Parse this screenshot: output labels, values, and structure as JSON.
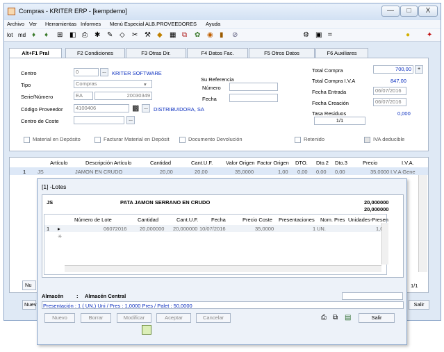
{
  "window": {
    "title": "Compras - KRITER ERP - [kempdemo]",
    "minimize": "—",
    "maximize": "□",
    "close": "X"
  },
  "menu": [
    "Archivo",
    "Ver",
    "Herramientas",
    "Informes",
    "Menú Especial ALB.PROVEEDORES",
    "Ayuda"
  ],
  "toolbar": {
    "lot": "lot",
    "md": "md"
  },
  "tabs": [
    "Alt+F1 Pral",
    "F2 Condiciones",
    "F3 Otras Dir.",
    "F4 Datos Fac.",
    "F5 Otros Datos",
    "F6 Auxiliares"
  ],
  "form": {
    "centro_label": "Centro",
    "centro_value": "0",
    "centro_name": "KRITER SOFTWARE",
    "tipo_label": "Tipo",
    "tipo_value": "Compras",
    "serie_label": "Serie/Número",
    "serie_value": "EA",
    "numero_value": "20030349",
    "codprov_label": "Código Proveedor",
    "codprov_value": "4100406",
    "prov_name": "DISTRIBUIDORA, SA",
    "coste_label": "Centro de Coste",
    "suref_label": "Su Referencia",
    "numero_label": "Número",
    "fecha_label": "Fecha",
    "total_compra_label": "Total Compra",
    "total_compra_value": "700,00",
    "total_iva_label": "Total Compra I.V.A",
    "total_iva_value": "847,00",
    "fecha_entrada_label": "Fecha Entrada",
    "fecha_entrada_value": "06/07/2016",
    "fecha_creacion_label": "Fecha Creación",
    "fecha_creacion_value": "06/07/2016",
    "tasa_label": "Tasa Residuos",
    "tasa_value": "0,000",
    "page": "1/1",
    "checks": [
      "Material en Depósito",
      "Facturar Material en Depósit",
      "Documento Devolución",
      "Retenido",
      "IVA deducible"
    ]
  },
  "grid": {
    "headers": [
      "Artículo",
      "Descripción Artículo",
      "Cantidad",
      "Cant.U.F.",
      "Valor Origen",
      "Factor Origen",
      "DTO.",
      "Dto.2",
      "Dto.3",
      "Precio",
      "I.V.A."
    ],
    "row": [
      "1",
      "JS",
      "JAMON EN CRUDO",
      "20,00",
      "20,00",
      "35,0000",
      "1,00",
      "0,00",
      "0,00",
      "0,00",
      "35,0000",
      "I.V.A Gene"
    ],
    "page": "1/1",
    "bottom_left": "Nu",
    "bottom_left2": "Nuev",
    "exit": "Salir"
  },
  "lotes": {
    "title": "[1] -Lotes",
    "code": "JS",
    "description": "PATA JAMON SERRANO EN CRUDO",
    "qty1": "20,000000",
    "qty2": "20,000000",
    "headers": [
      "Número de Lote",
      "Cantidad",
      "Cant.U.F.",
      "Fecha",
      "Precio Coste",
      "Presentaciones",
      "Nom. Pres",
      "Unidades-Presen"
    ],
    "row": [
      "1",
      "06072016",
      "20,000000",
      "20,000000",
      "10/07/2016",
      "35,0000",
      "1",
      "UN.",
      "1,0"
    ],
    "almacen_label": "Almacén",
    "almacen_sep": ":",
    "almacen_value": "Almacén Central",
    "presentacion": "Presentación : 1  ( UN.)  Uni / Pres : 1,0000 Pres / Palet : 50,0000",
    "buttons": [
      "Nuevo",
      "Borrar",
      "Modificar",
      "Aceptar",
      "Cancelar"
    ],
    "exit": "Salir"
  }
}
